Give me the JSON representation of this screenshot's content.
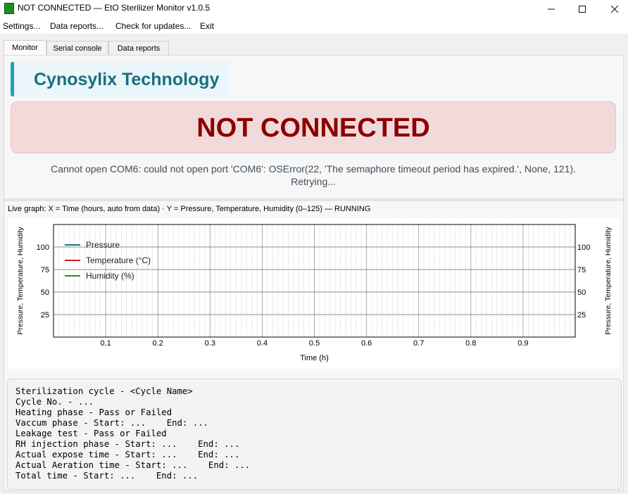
{
  "window": {
    "title": "NOT CONNECTED — EtO Sterilizer Monitor v1.0.5"
  },
  "menu": [
    "Settings...",
    "Data reports...",
    "Check for updates...",
    "Exit"
  ],
  "tabs": [
    "Monitor",
    "Serial console",
    "Data reports"
  ],
  "company": "Cynosylix Technology",
  "status": "NOT CONNECTED",
  "error_line1": "Cannot open COM6: could not open port 'COM6': OSError(22, 'The semaphore timeout period has expired.', None, 121).",
  "error_line2": "Retrying...",
  "graph_caption": "Live graph: X = Time (hours, auto from data) · Y = Pressure, Temperature, Humidity (0–125) — RUNNING",
  "colors": {
    "brand": "#1b6f80",
    "status": "#8b0000",
    "pressure": "#1f6f8b",
    "temperature": "#cc2222",
    "humidity": "#2e8b2e"
  },
  "chart_data": {
    "type": "line",
    "xlabel": "Time (h)",
    "ylabel": "Pressure, Temperature, Humidity",
    "xlim": [
      0,
      1
    ],
    "ylim": [
      0,
      125
    ],
    "x_ticks": [
      "0.1",
      "0.2",
      "0.3",
      "0.4",
      "0.5",
      "0.6",
      "0.7",
      "0.8",
      "0.9"
    ],
    "y_ticks": [
      "25",
      "50",
      "75",
      "100"
    ],
    "series": [
      {
        "name": "Pressure",
        "values": []
      },
      {
        "name": "Temperature (°C)",
        "values": []
      },
      {
        "name": "Humidity (%)",
        "values": []
      }
    ],
    "legend": "top-left",
    "grid": true
  },
  "cycle": [
    "Sterilization cycle - <Cycle Name>",
    "Cycle No. - ...",
    "Heating phase - Pass or Failed",
    "Vaccum phase - Start: ...    End: ...",
    "Leakage test - Pass or Failed",
    "RH injection phase - Start: ...    End: ...",
    "Actual expose time - Start: ...    End: ...",
    "Actual Aeration time - Start: ...    End: ...",
    "Total time - Start: ...    End: ..."
  ]
}
